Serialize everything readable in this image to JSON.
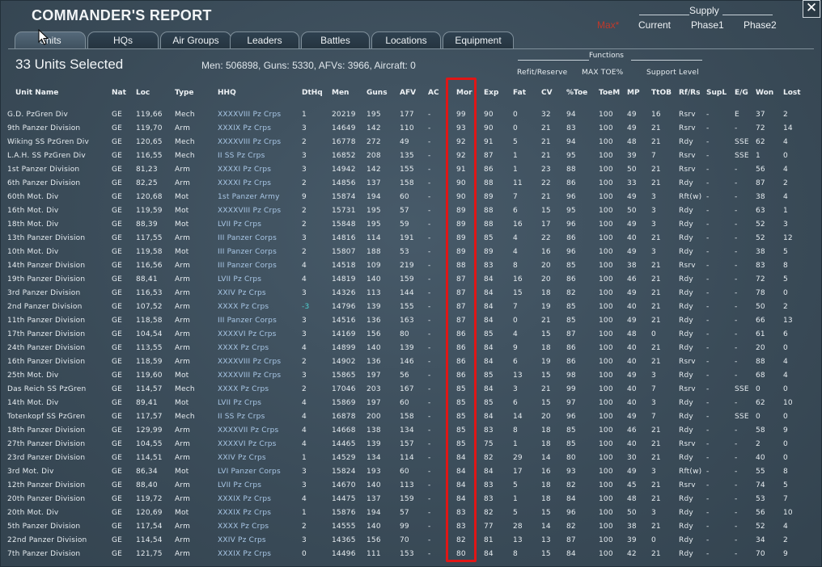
{
  "window": {
    "title": "COMMANDER'S REPORT",
    "close_glyph": "✕"
  },
  "supply": {
    "label": "Supply",
    "options": [
      "Max*",
      "Current",
      "Phase1",
      "Phase2"
    ],
    "active": 0
  },
  "tabs": [
    "Units",
    "HQs",
    "Air Groups",
    "Leaders",
    "Battles",
    "Locations",
    "Equipment"
  ],
  "active_tab": 0,
  "selection": {
    "title": "33 Units Selected",
    "summary": "Men: 506898, Guns: 5330, AFVs: 3966, Aircraft: 0"
  },
  "functions": {
    "label": "Functions",
    "options": [
      "Refit/Reserve",
      "MAX TOE%",
      "Support Level"
    ]
  },
  "colors": {
    "background": "#3c4e5c",
    "hhq_text": "#a9c7e6",
    "highlight": "#e01616",
    "active_supply": "#c0392b",
    "negative_dthq": "#4fd1d1"
  },
  "table": {
    "headers": [
      "Unit Name",
      "Nat",
      "Loc",
      "Type",
      "HHQ",
      "DtHq",
      "Men",
      "Guns",
      "AFV",
      "AC",
      "Mor",
      "Exp",
      "Fat",
      "CV",
      "%Toe",
      "ToeM",
      "MP",
      "TtOB",
      "Rf/Rs",
      "SupL",
      "E/G",
      "Won",
      "Lost"
    ],
    "rows": [
      [
        "G.D. PzGren Div",
        "GE",
        "119,66",
        "Mech",
        "XXXXVIII Pz Crps",
        "1",
        "20219",
        "195",
        "177",
        "-",
        "99",
        "90",
        "0",
        "32",
        "94",
        "100",
        "49",
        "16",
        "Rsrv",
        "-",
        "E",
        "37",
        "2"
      ],
      [
        "9th Panzer Division",
        "GE",
        "119,70",
        "Arm",
        "XXXIX Pz Crps",
        "3",
        "14649",
        "142",
        "110",
        "-",
        "93",
        "90",
        "0",
        "21",
        "83",
        "100",
        "49",
        "21",
        "Rsrv",
        "-",
        "-",
        "72",
        "14"
      ],
      [
        "Wiking SS PzGren Div",
        "GE",
        "120,65",
        "Mech",
        "XXXXVIII Pz Crps",
        "2",
        "16778",
        "272",
        "49",
        "-",
        "92",
        "91",
        "5",
        "21",
        "94",
        "100",
        "48",
        "21",
        "Rdy",
        "-",
        "SSE",
        "62",
        "4"
      ],
      [
        "L.A.H. SS PzGren Div",
        "GE",
        "116,55",
        "Mech",
        "II SS Pz Crps",
        "3",
        "16852",
        "208",
        "135",
        "-",
        "92",
        "87",
        "1",
        "21",
        "95",
        "100",
        "39",
        "7",
        "Rsrv",
        "-",
        "SSE",
        "1",
        "0"
      ],
      [
        "1st Panzer Division",
        "GE",
        "81,23",
        "Arm",
        "XXXXI Pz Crps",
        "3",
        "14942",
        "142",
        "155",
        "-",
        "91",
        "86",
        "1",
        "23",
        "88",
        "100",
        "50",
        "21",
        "Rsrv",
        "-",
        "-",
        "56",
        "4"
      ],
      [
        "6th Panzer Division",
        "GE",
        "82,25",
        "Arm",
        "XXXXI Pz Crps",
        "2",
        "14856",
        "137",
        "158",
        "-",
        "90",
        "88",
        "11",
        "22",
        "86",
        "100",
        "33",
        "21",
        "Rdy",
        "-",
        "-",
        "87",
        "2"
      ],
      [
        "60th Mot. Div",
        "GE",
        "120,68",
        "Mot",
        "1st Panzer Army",
        "9",
        "15874",
        "194",
        "60",
        "-",
        "90",
        "89",
        "7",
        "21",
        "96",
        "100",
        "49",
        "3",
        "Rft(w)",
        "-",
        "-",
        "38",
        "4"
      ],
      [
        "16th Mot. Div",
        "GE",
        "119,59",
        "Mot",
        "XXXXVIII Pz Crps",
        "2",
        "15731",
        "195",
        "57",
        "-",
        "89",
        "88",
        "6",
        "15",
        "95",
        "100",
        "50",
        "3",
        "Rdy",
        "-",
        "-",
        "63",
        "1"
      ],
      [
        "18th Mot. Div",
        "GE",
        "88,39",
        "Mot",
        "LVII Pz Crps",
        "2",
        "15848",
        "195",
        "59",
        "-",
        "89",
        "88",
        "16",
        "17",
        "96",
        "100",
        "49",
        "3",
        "Rdy",
        "-",
        "-",
        "52",
        "3"
      ],
      [
        "13th Panzer Division",
        "GE",
        "117,55",
        "Arm",
        "III Panzer Corps",
        "3",
        "14816",
        "114",
        "191",
        "-",
        "89",
        "85",
        "4",
        "22",
        "86",
        "100",
        "40",
        "21",
        "Rdy",
        "-",
        "-",
        "52",
        "12"
      ],
      [
        "10th Mot. Div",
        "GE",
        "119,58",
        "Mot",
        "III Panzer Corps",
        "2",
        "15807",
        "188",
        "53",
        "-",
        "89",
        "89",
        "4",
        "16",
        "96",
        "100",
        "49",
        "3",
        "Rdy",
        "-",
        "-",
        "38",
        "5"
      ],
      [
        "14th Panzer Division",
        "GE",
        "116,56",
        "Arm",
        "III Panzer Corps",
        "4",
        "14518",
        "109",
        "219",
        "-",
        "88",
        "83",
        "8",
        "20",
        "85",
        "100",
        "38",
        "21",
        "Rsrv",
        "-",
        "-",
        "83",
        "8"
      ],
      [
        "19th Panzer Division",
        "GE",
        "88,41",
        "Arm",
        "LVII Pz Crps",
        "4",
        "14819",
        "140",
        "159",
        "-",
        "87",
        "84",
        "16",
        "20",
        "86",
        "100",
        "46",
        "21",
        "Rdy",
        "-",
        "-",
        "72",
        "5"
      ],
      [
        "3rd Panzer Division",
        "GE",
        "116,53",
        "Arm",
        "XXIV Pz Crps",
        "3",
        "14326",
        "113",
        "144",
        "-",
        "87",
        "84",
        "15",
        "18",
        "82",
        "100",
        "49",
        "21",
        "Rdy",
        "-",
        "-",
        "78",
        "0"
      ],
      [
        "2nd Panzer Division",
        "GE",
        "107,52",
        "Arm",
        "XXXX Pz Crps",
        "-3",
        "14796",
        "139",
        "155",
        "-",
        "87",
        "84",
        "7",
        "19",
        "85",
        "100",
        "40",
        "21",
        "Rdy",
        "-",
        "-",
        "50",
        "2"
      ],
      [
        "11th Panzer Division",
        "GE",
        "118,58",
        "Arm",
        "III Panzer Corps",
        "3",
        "14516",
        "136",
        "163",
        "-",
        "87",
        "84",
        "0",
        "21",
        "85",
        "100",
        "49",
        "21",
        "Rdy",
        "-",
        "-",
        "66",
        "13"
      ],
      [
        "17th Panzer Division",
        "GE",
        "104,54",
        "Arm",
        "XXXXVI Pz Crps",
        "3",
        "14169",
        "156",
        "80",
        "-",
        "86",
        "85",
        "4",
        "15",
        "87",
        "100",
        "48",
        "0",
        "Rdy",
        "-",
        "-",
        "61",
        "6"
      ],
      [
        "24th Panzer Division",
        "GE",
        "113,55",
        "Arm",
        "XXXX Pz Crps",
        "4",
        "14899",
        "140",
        "139",
        "-",
        "86",
        "84",
        "9",
        "18",
        "86",
        "100",
        "40",
        "21",
        "Rdy",
        "-",
        "-",
        "20",
        "0"
      ],
      [
        "16th Panzer Division",
        "GE",
        "118,59",
        "Arm",
        "XXXXVIII Pz Crps",
        "2",
        "14902",
        "136",
        "146",
        "-",
        "86",
        "84",
        "6",
        "19",
        "86",
        "100",
        "40",
        "21",
        "Rsrv",
        "-",
        "-",
        "88",
        "4"
      ],
      [
        "25th Mot. Div",
        "GE",
        "119,60",
        "Mot",
        "XXXXVIII Pz Crps",
        "3",
        "15865",
        "197",
        "56",
        "-",
        "86",
        "85",
        "13",
        "15",
        "98",
        "100",
        "49",
        "3",
        "Rdy",
        "-",
        "-",
        "68",
        "4"
      ],
      [
        "Das Reich SS PzGren",
        "GE",
        "114,57",
        "Mech",
        "XXXX Pz Crps",
        "2",
        "17046",
        "203",
        "167",
        "-",
        "85",
        "84",
        "3",
        "21",
        "99",
        "100",
        "40",
        "7",
        "Rsrv",
        "-",
        "SSE",
        "0",
        "0"
      ],
      [
        "14th Mot. Div",
        "GE",
        "89,41",
        "Mot",
        "LVII Pz Crps",
        "4",
        "15869",
        "197",
        "60",
        "-",
        "85",
        "85",
        "6",
        "15",
        "97",
        "100",
        "40",
        "3",
        "Rdy",
        "-",
        "-",
        "62",
        "10"
      ],
      [
        "Totenkopf SS PzGren",
        "GE",
        "117,57",
        "Mech",
        "II SS Pz Crps",
        "4",
        "16878",
        "200",
        "158",
        "-",
        "85",
        "84",
        "14",
        "20",
        "96",
        "100",
        "49",
        "7",
        "Rdy",
        "-",
        "SSE",
        "0",
        "0"
      ],
      [
        "18th Panzer Division",
        "GE",
        "129,99",
        "Arm",
        "XXXXVII Pz Crps",
        "4",
        "14668",
        "138",
        "134",
        "-",
        "85",
        "83",
        "8",
        "18",
        "85",
        "100",
        "46",
        "21",
        "Rdy",
        "-",
        "-",
        "58",
        "9"
      ],
      [
        "27th Panzer Division",
        "GE",
        "104,55",
        "Arm",
        "XXXXVI Pz Crps",
        "4",
        "14465",
        "139",
        "157",
        "-",
        "85",
        "75",
        "1",
        "18",
        "85",
        "100",
        "40",
        "21",
        "Rsrv",
        "-",
        "-",
        "2",
        "0"
      ],
      [
        "23rd Panzer Division",
        "GE",
        "114,51",
        "Arm",
        "XXIV Pz Crps",
        "1",
        "14529",
        "134",
        "114",
        "-",
        "84",
        "82",
        "29",
        "14",
        "80",
        "100",
        "30",
        "21",
        "Rdy",
        "-",
        "-",
        "40",
        "0"
      ],
      [
        "3rd Mot. Div",
        "GE",
        "86,34",
        "Mot",
        "LVI Panzer Corps",
        "3",
        "15824",
        "193",
        "60",
        "-",
        "84",
        "84",
        "17",
        "16",
        "93",
        "100",
        "49",
        "3",
        "Rft(w)",
        "-",
        "-",
        "55",
        "8"
      ],
      [
        "12th Panzer Division",
        "GE",
        "88,40",
        "Arm",
        "LVII Pz Crps",
        "3",
        "14670",
        "140",
        "113",
        "-",
        "84",
        "83",
        "5",
        "18",
        "82",
        "100",
        "45",
        "21",
        "Rsrv",
        "-",
        "-",
        "74",
        "5"
      ],
      [
        "20th Panzer Division",
        "GE",
        "119,72",
        "Arm",
        "XXXIX Pz Crps",
        "4",
        "14475",
        "137",
        "159",
        "-",
        "84",
        "83",
        "1",
        "18",
        "84",
        "100",
        "48",
        "21",
        "Rdy",
        "-",
        "-",
        "53",
        "7"
      ],
      [
        "20th Mot. Div",
        "GE",
        "120,69",
        "Mot",
        "XXXIX Pz Crps",
        "1",
        "15876",
        "194",
        "57",
        "-",
        "83",
        "82",
        "5",
        "15",
        "96",
        "100",
        "50",
        "3",
        "Rdy",
        "-",
        "-",
        "56",
        "10"
      ],
      [
        "5th Panzer Division",
        "GE",
        "117,54",
        "Arm",
        "XXXX Pz Crps",
        "2",
        "14555",
        "140",
        "99",
        "-",
        "83",
        "77",
        "28",
        "14",
        "82",
        "100",
        "38",
        "21",
        "Rdy",
        "-",
        "-",
        "52",
        "4"
      ],
      [
        "22nd Panzer Division",
        "GE",
        "114,54",
        "Arm",
        "XXIV Pz Crps",
        "3",
        "14365",
        "156",
        "70",
        "-",
        "82",
        "81",
        "13",
        "13",
        "87",
        "100",
        "39",
        "0",
        "Rdy",
        "-",
        "-",
        "34",
        "2"
      ],
      [
        "7th Panzer Division",
        "GE",
        "121,75",
        "Arm",
        "XXXIX Pz Crps",
        "0",
        "14496",
        "111",
        "153",
        "-",
        "80",
        "84",
        "8",
        "15",
        "84",
        "100",
        "42",
        "21",
        "Rdy",
        "-",
        "-",
        "70",
        "9"
      ]
    ]
  }
}
